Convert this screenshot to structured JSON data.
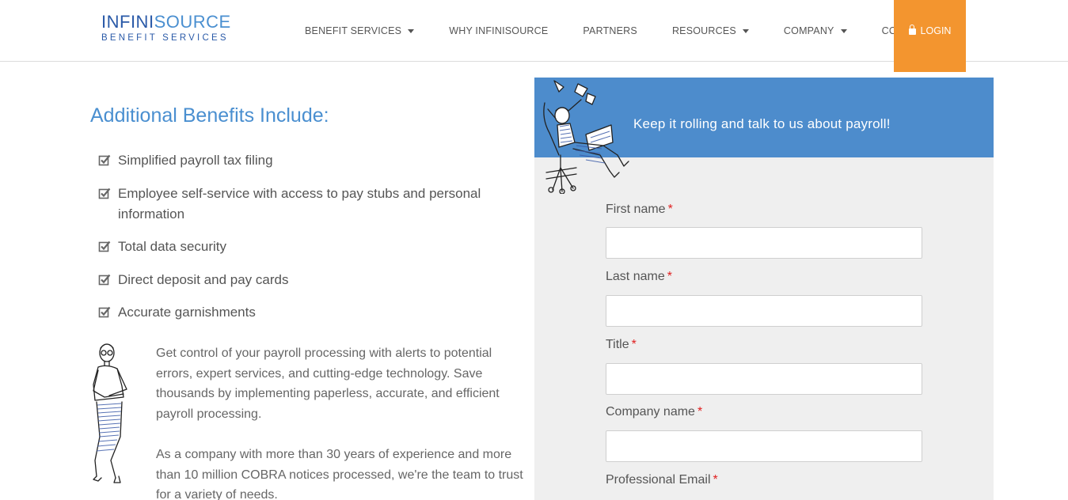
{
  "header": {
    "logo_line1_part1": "INFINI",
    "logo_line1_part2": "SOURCE",
    "logo_line2": "BENEFIT SERVICES",
    "nav": [
      {
        "label": "BENEFIT SERVICES",
        "has_dropdown": true
      },
      {
        "label": "WHY INFINISOURCE",
        "has_dropdown": false
      },
      {
        "label": "PARTNERS",
        "has_dropdown": false
      },
      {
        "label": "RESOURCES",
        "has_dropdown": true
      },
      {
        "label": "COMPANY",
        "has_dropdown": true
      },
      {
        "label": "CONTACT",
        "has_dropdown": true
      }
    ],
    "login_label": "LOGIN"
  },
  "left": {
    "heading": "Additional Benefits Include:",
    "benefits": [
      "Simplified payroll tax filing",
      "Employee self-service with access to pay stubs and personal information",
      "Total data security",
      "Direct deposit and pay cards",
      "Accurate garnishments"
    ],
    "paragraph1": "Get control of your payroll processing with alerts to potential errors, expert services, and cutting-edge technology. Save thousands by implementing paperless, accurate, and efficient payroll processing.",
    "paragraph2": "As a company with more than 30 years of experience and more than 10 million COBRA notices processed, we're the team to trust for a variety of needs."
  },
  "form": {
    "banner": "Keep it rolling and talk to us about payroll!",
    "required_mark": "*",
    "fields": [
      {
        "label": "First name",
        "value": ""
      },
      {
        "label": "Last name",
        "value": ""
      },
      {
        "label": "Title",
        "value": ""
      },
      {
        "label": "Company name",
        "value": ""
      },
      {
        "label": "Professional Email",
        "value": ""
      }
    ]
  },
  "colors": {
    "brand_blue": "#4a8fd0",
    "banner_blue": "#4d8ccc",
    "login_orange": "#f3952f",
    "required_red": "#e02020"
  }
}
